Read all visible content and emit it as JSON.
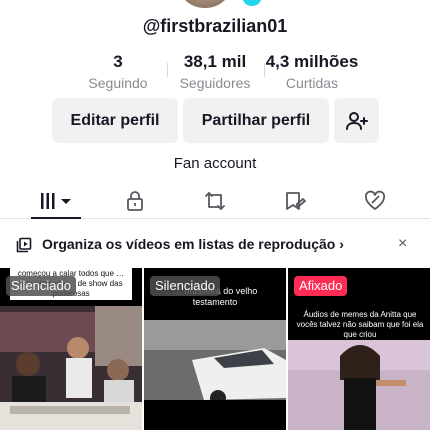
{
  "profile": {
    "username": "@firstbrazilian01",
    "bio": "Fan account"
  },
  "stats": [
    {
      "value": "3",
      "label": "Seguindo"
    },
    {
      "value": "38,1 mil",
      "label": "Seguidores"
    },
    {
      "value": "4,3 milhões",
      "label": "Curtidas"
    }
  ],
  "actions": {
    "edit_label": "Editar perfil",
    "share_label": "Partilhar perfil",
    "add_friend_icon": "add-person-icon"
  },
  "tabs": [
    {
      "icon": "grid-icon",
      "active": true
    },
    {
      "icon": "lock-icon",
      "active": false
    },
    {
      "icon": "repost-icon",
      "active": false
    },
    {
      "icon": "saved-icon",
      "active": false
    },
    {
      "icon": "liked-icon",
      "active": false
    }
  ],
  "playlist_banner": {
    "text": "Organiza os vídeos em listas de reprodução",
    "chevron": "›",
    "close": "×"
  },
  "videos": [
    {
      "badge": "Silenciado",
      "caption": "começou a calar todos que … que ela seria … de show das poderosas"
    },
    {
      "badge": "Silenciado",
      "caption": "… brasileira do velho testamento"
    },
    {
      "badge": "Afixado",
      "caption": "Áudios de memes da Anitta que vocês talvez não saibam que foi ela que criou"
    }
  ],
  "colors": {
    "text": "#161823",
    "secondary": "#8a8b91",
    "button_bg": "#f1f1f2",
    "pinned": "#fe2c55",
    "verified": "#20d5ec"
  }
}
